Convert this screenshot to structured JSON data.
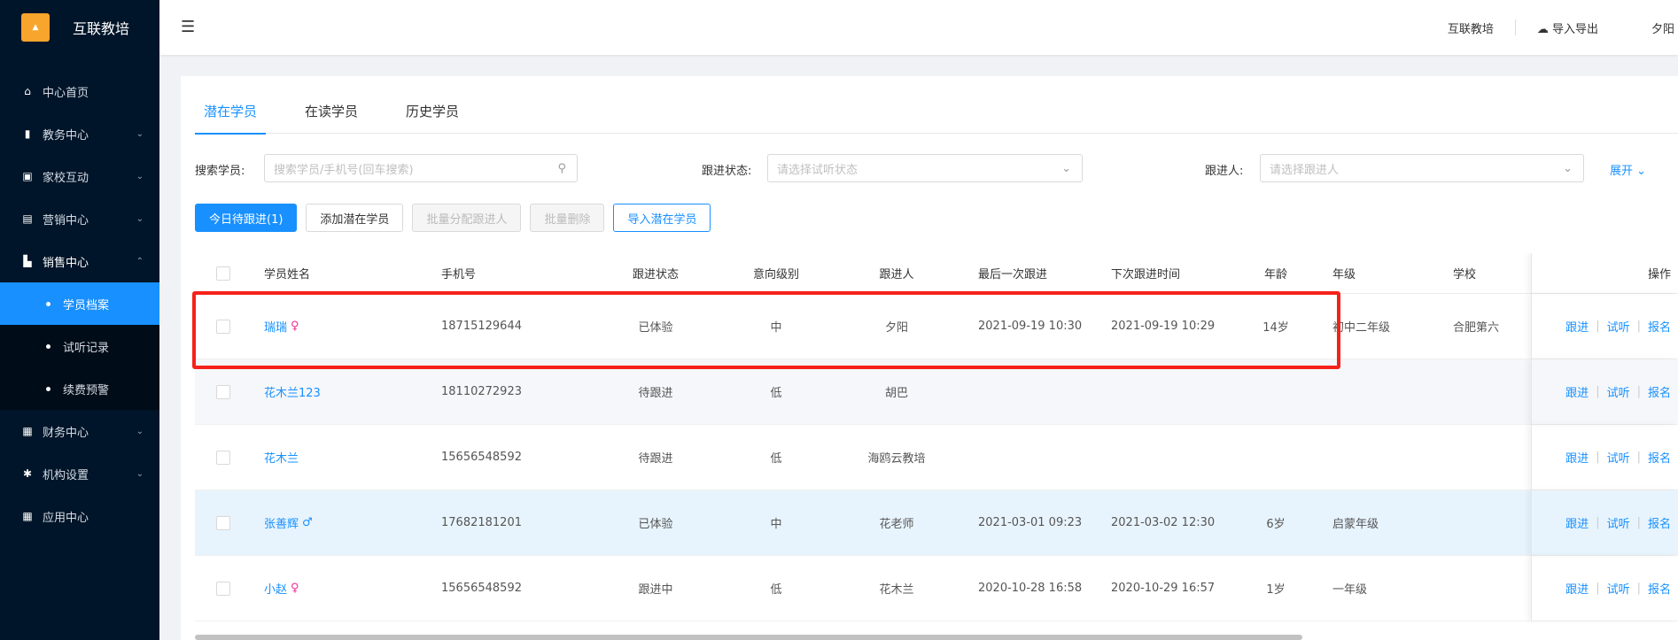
{
  "app": {
    "title": "互联教培",
    "logo_text": "互联教培"
  },
  "sidebar": {
    "items": [
      {
        "label": "中心首页",
        "icon": "home-icon"
      },
      {
        "label": "教务中心",
        "icon": "book-icon"
      },
      {
        "label": "家校互动",
        "icon": "chat-icon"
      },
      {
        "label": "营销中心",
        "icon": "bag-icon"
      },
      {
        "label": "销售中心",
        "icon": "chart-icon"
      },
      {
        "label": "财务中心",
        "icon": "wallet-icon"
      },
      {
        "label": "机构设置",
        "icon": "gear-icon"
      },
      {
        "label": "应用中心",
        "icon": "grid-icon"
      }
    ],
    "sales_sub": [
      {
        "label": "学员档案"
      },
      {
        "label": "试听记录"
      },
      {
        "label": "续费预警"
      }
    ]
  },
  "header": {
    "org": "互联教培",
    "import_export": "导入导出",
    "user": "夕阳"
  },
  "tabs": [
    {
      "label": "潜在学员"
    },
    {
      "label": "在读学员"
    },
    {
      "label": "历史学员"
    }
  ],
  "filters": {
    "search_label": "搜索学员:",
    "search_placeholder": "搜索学员/手机号(回车搜索)",
    "status_label": "跟进状态:",
    "status_placeholder": "请选择试听状态",
    "follower_label": "跟进人:",
    "follower_placeholder": "请选择跟进人",
    "expand": "展开"
  },
  "actions": {
    "today": "今日待跟进(1)",
    "add": "添加潜在学员",
    "batch_assign": "批量分配跟进人",
    "batch_delete": "批量删除",
    "import": "导入潜在学员"
  },
  "table": {
    "headers": {
      "name": "学员姓名",
      "phone": "手机号",
      "status": "跟进状态",
      "level": "意向级别",
      "follower": "跟进人",
      "last": "最后一次跟进",
      "next": "下次跟进时间",
      "age": "年龄",
      "grade": "年级",
      "school": "学校",
      "ops": "操作"
    },
    "op_labels": {
      "follow": "跟进",
      "trial": "试听",
      "enroll": "报名"
    },
    "rows": [
      {
        "name": "瑞瑞",
        "gender": "♀",
        "phone": "18715129644",
        "status": "已体验",
        "level": "中",
        "follower": "夕阳",
        "last": "2021-09-19 10:30",
        "next": "2021-09-19 10:29",
        "age": "14岁",
        "grade": "初中二年级",
        "school": "合肥第六"
      },
      {
        "name": "花木兰123",
        "gender": "",
        "phone": "18110272923",
        "status": "待跟进",
        "level": "低",
        "follower": "胡巴",
        "last": "",
        "next": "",
        "age": "",
        "grade": "",
        "school": ""
      },
      {
        "name": "花木兰",
        "gender": "",
        "phone": "15656548592",
        "status": "待跟进",
        "level": "低",
        "follower": "海鸥云教培",
        "last": "",
        "next": "",
        "age": "",
        "grade": "",
        "school": ""
      },
      {
        "name": "张善辉",
        "gender": "♂",
        "phone": "17682181201",
        "status": "已体验",
        "level": "中",
        "follower": "花老师",
        "last": "2021-03-01 09:23",
        "next": "2021-03-02 12:30",
        "age": "6岁",
        "grade": "启蒙年级",
        "school": ""
      },
      {
        "name": "小赵",
        "gender": "♀",
        "phone": "15656548592",
        "status": "跟进中",
        "level": "低",
        "follower": "花木兰",
        "last": "2020-10-28 16:58",
        "next": "2020-10-29 16:57",
        "age": "1岁",
        "grade": "一年级",
        "school": ""
      }
    ]
  },
  "colors": {
    "primary": "#1890ff",
    "sidebar": "#001529",
    "highlight_box": "#f5221b"
  }
}
